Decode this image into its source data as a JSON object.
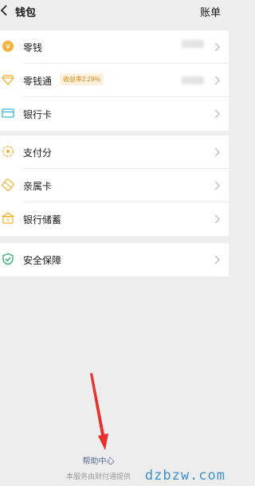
{
  "header": {
    "title": "钱包",
    "bill": "账单"
  },
  "group1": [
    {
      "label": "零钱",
      "icon": "coin-icon"
    },
    {
      "label": "零钱通",
      "icon": "diamond-icon",
      "badge": "收益率2.29%"
    },
    {
      "label": "银行卡",
      "icon": "bank-card-icon"
    }
  ],
  "group2": [
    {
      "label": "支付分",
      "icon": "score-icon"
    },
    {
      "label": "亲属卡",
      "icon": "family-card-icon"
    },
    {
      "label": "银行储蓄",
      "icon": "bank-building-icon"
    }
  ],
  "group3": [
    {
      "label": "安全保障",
      "icon": "shield-check-icon"
    }
  ],
  "footer": {
    "help": "帮助中心",
    "provider": "本服务由财付通提供",
    "watermark": "dzbzw.com"
  },
  "colors": {
    "background": "#ededed",
    "link": "#576b95",
    "icon_gold": "#f3b33d",
    "icon_cyan": "#3bb7d3",
    "icon_green": "#2aae67",
    "badge_bg": "#fdf0dc",
    "annotation_arrow": "#e8302d"
  }
}
